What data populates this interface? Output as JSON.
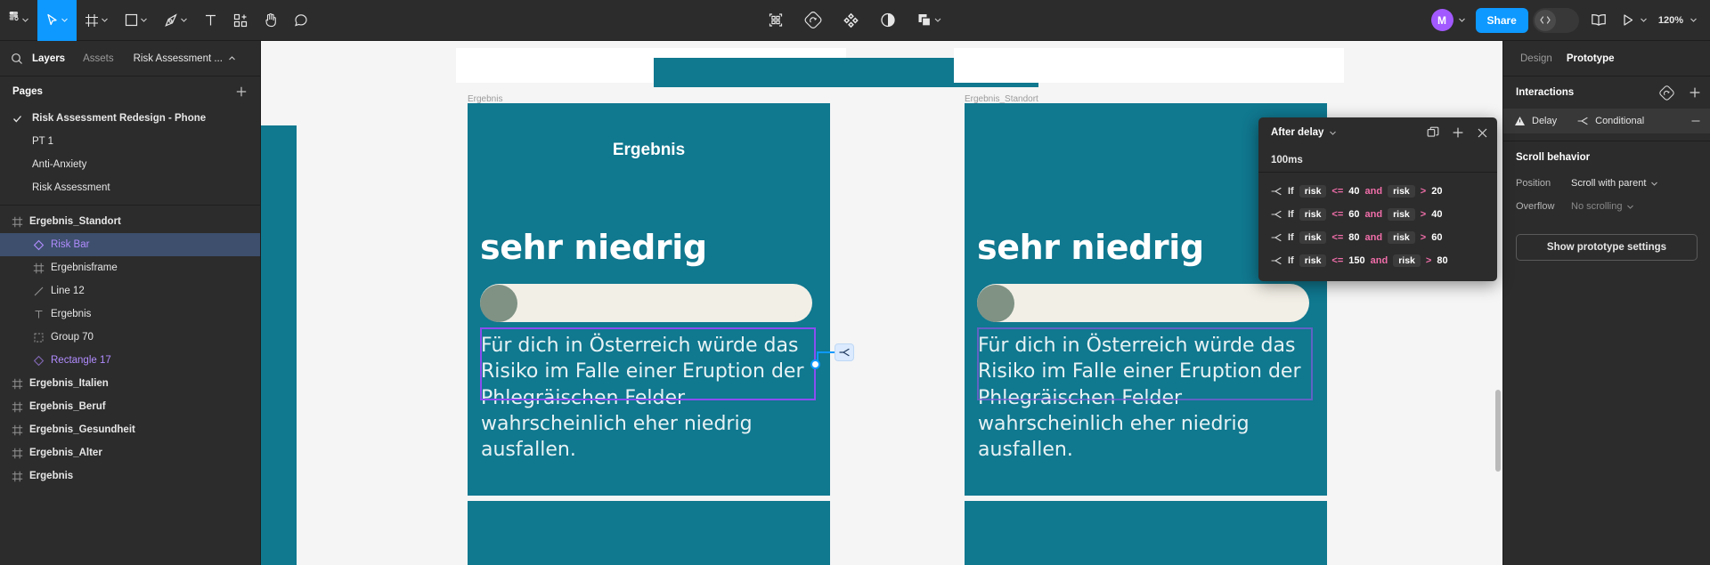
{
  "toolbar": {
    "left_tools": [
      {
        "name": "figma-menu",
        "icon": "figma-logo",
        "caret": true
      },
      {
        "name": "move-tool",
        "icon": "cursor",
        "caret": true,
        "active": true
      },
      {
        "name": "frame-tool",
        "icon": "frame",
        "caret": true
      },
      {
        "name": "shape-tool",
        "icon": "square",
        "caret": true
      },
      {
        "name": "pen-tool",
        "icon": "pen",
        "caret": true
      },
      {
        "name": "text-tool",
        "icon": "text",
        "caret": false
      },
      {
        "name": "resources-tool",
        "icon": "components",
        "caret": false
      },
      {
        "name": "hand-tool",
        "icon": "hand",
        "caret": false
      },
      {
        "name": "comment-tool",
        "icon": "comment",
        "caret": false
      }
    ],
    "center_tools": [
      {
        "name": "actions",
        "icon": "grid-dots"
      },
      {
        "name": "plugins",
        "icon": "plugin-diamond"
      },
      {
        "name": "widgets",
        "icon": "widget-clover"
      },
      {
        "name": "appearance",
        "icon": "half-circle"
      },
      {
        "name": "multiplayer",
        "icon": "layers-stack",
        "caret": true
      }
    ],
    "user_initial": "M",
    "share_label": "Share",
    "dev_mode_icon": "code-brackets",
    "book_icon": "book-open",
    "present_icon": "play-triangle",
    "zoom_level": "120%"
  },
  "left_panel": {
    "search_icon": "search-icon",
    "tabs": [
      {
        "label": "Layers",
        "active": true
      },
      {
        "label": "Assets",
        "active": false
      }
    ],
    "file_name": "Risk Assessment ...",
    "pages_title": "Pages",
    "add_page_icon": "plus-icon",
    "pages": [
      {
        "label": "Risk Assessment Redesign - Phone",
        "selected": true
      },
      {
        "label": "PT 1",
        "selected": false
      },
      {
        "label": "Anti-Anxiety",
        "selected": false
      },
      {
        "label": "Risk Assessment",
        "selected": false
      }
    ],
    "layers": [
      {
        "label": "Ergebnis_Standort",
        "icon": "frame-icon",
        "indent": 0,
        "bold": true,
        "selected": false,
        "purple": false
      },
      {
        "label": "Risk Bar",
        "icon": "component-icon",
        "indent": 1,
        "bold": false,
        "selected": true,
        "purple": true
      },
      {
        "label": "Ergebnisframe",
        "icon": "frame-icon",
        "indent": 1,
        "bold": false,
        "selected": false,
        "purple": false
      },
      {
        "label": "Line 12",
        "icon": "line-icon",
        "indent": 1,
        "bold": false,
        "selected": false,
        "purple": false
      },
      {
        "label": "Ergebnis",
        "icon": "text-icon",
        "indent": 1,
        "bold": false,
        "selected": false,
        "purple": false
      },
      {
        "label": "Group 70",
        "icon": "group-icon",
        "indent": 1,
        "bold": false,
        "selected": false,
        "purple": false
      },
      {
        "label": "Rectangle 17",
        "icon": "component-icon",
        "indent": 1,
        "bold": false,
        "selected": false,
        "purple": true
      },
      {
        "label": "Ergebnis_Italien",
        "icon": "frame-icon",
        "indent": 0,
        "bold": true,
        "selected": false,
        "purple": false
      },
      {
        "label": "Ergebnis_Beruf",
        "icon": "frame-icon",
        "indent": 0,
        "bold": true,
        "selected": false,
        "purple": false
      },
      {
        "label": "Ergebnis_Gesundheit",
        "icon": "frame-icon",
        "indent": 0,
        "bold": true,
        "selected": false,
        "purple": false
      },
      {
        "label": "Ergebnis_Alter",
        "icon": "frame-icon",
        "indent": 0,
        "bold": true,
        "selected": false,
        "purple": false
      },
      {
        "label": "Ergebnis",
        "icon": "frame-icon",
        "indent": 0,
        "bold": true,
        "selected": false,
        "purple": false
      }
    ]
  },
  "canvas": {
    "background": "#f5f5f5",
    "frames": [
      {
        "label": "",
        "label_visible": false
      },
      {
        "label": "Ergebnis",
        "label_visible": true
      },
      {
        "label": "Ergebnis_Standort",
        "label_visible": true
      }
    ],
    "card": {
      "title": "Ergebnis",
      "heading": "sehr niedrig",
      "body": "Für dich in Österreich würde das Risiko im Falle einer Eruption der Phlegräischen Felder wahrscheinlich eher niedrig ausfallen.",
      "bg_color": "#10788f",
      "track_color": "#f2efe6",
      "knob_color": "#7f9284"
    },
    "selection_color": "#8c4cf0",
    "connector_color": "#0d99ff",
    "connector_badge_icon": "conditional-icon"
  },
  "popup": {
    "trigger_label": "After delay",
    "trigger_caret_icon": "chevron-down-icon",
    "duplicate_icon": "duplicate-icon",
    "add_icon": "plus-icon",
    "close_icon": "close-icon",
    "delay_value": "100ms",
    "conditions": [
      {
        "icon": "conditional-icon",
        "if": "If",
        "var1": "risk",
        "op1": "<=",
        "val1": "40",
        "and": "and",
        "var2": "risk",
        "op2": ">",
        "val2": "20"
      },
      {
        "icon": "conditional-icon",
        "if": "If",
        "var1": "risk",
        "op1": "<=",
        "val1": "60",
        "and": "and",
        "var2": "risk",
        "op2": ">",
        "val2": "40"
      },
      {
        "icon": "conditional-icon",
        "if": "If",
        "var1": "risk",
        "op1": "<=",
        "val1": "80",
        "and": "and",
        "var2": "risk",
        "op2": ">",
        "val2": "60"
      },
      {
        "icon": "conditional-icon",
        "if": "If",
        "var1": "risk",
        "op1": "<=",
        "val1": "150",
        "and": "and",
        "var2": "risk",
        "op2": ">",
        "val2": "80"
      }
    ]
  },
  "right_panel": {
    "tabs": [
      {
        "label": "Design",
        "active": false
      },
      {
        "label": "Prototype",
        "active": true
      }
    ],
    "interactions_title": "Interactions",
    "interactions_reset_icon": "prototype-icon",
    "interactions_add_icon": "plus-icon",
    "interaction": {
      "warning_icon": "warning-icon",
      "trigger_label": "Delay",
      "conditional_icon": "conditional-icon",
      "action_label": "Conditional",
      "remove_icon": "minus-icon"
    },
    "scroll_behavior_title": "Scroll behavior",
    "position_label": "Position",
    "position_value": "Scroll with parent",
    "overflow_label": "Overflow",
    "overflow_value": "No scrolling",
    "show_prototype_settings_label": "Show prototype settings"
  }
}
